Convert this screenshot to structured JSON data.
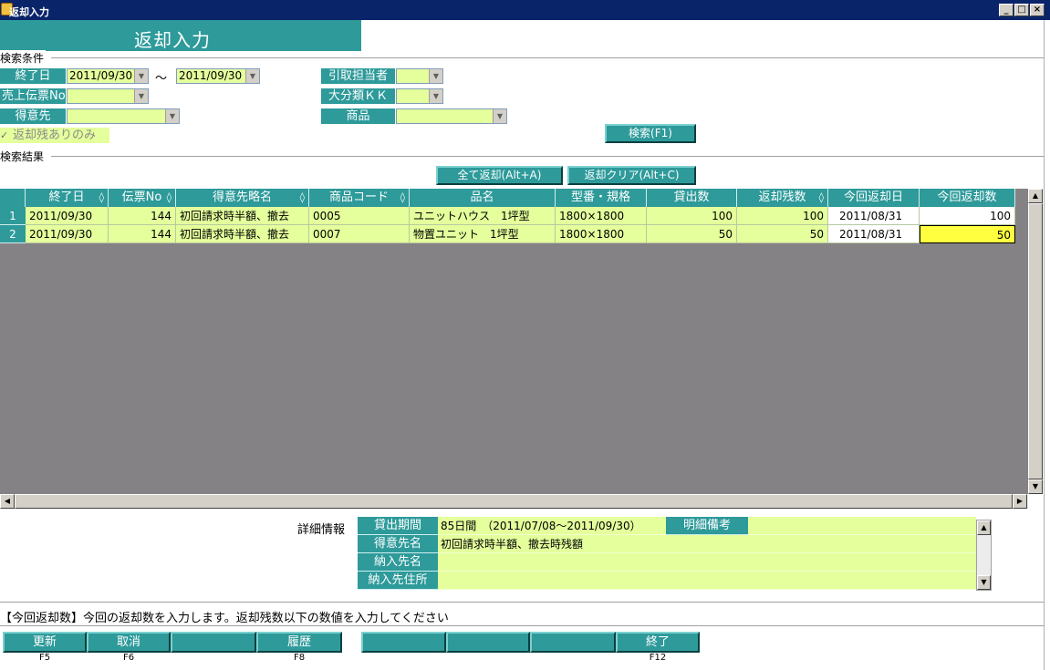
{
  "window": {
    "title": "返却入力",
    "controls": [
      "_",
      "□",
      "×"
    ]
  },
  "header": {
    "title": "返却入力"
  },
  "search": {
    "group_title": "検索条件",
    "end_date_label": "終了日",
    "date_from": "2011/09/30",
    "tilde": "～",
    "date_to": "2011/09/30",
    "slip_no_label": "売上伝票No",
    "customer_label": "得意先",
    "pickup_staff_label": "引取担当者",
    "category_label": "大分類ＫＫ",
    "product_label": "商品",
    "checkbox_label": "返却残ありのみ",
    "checkbox_mark": "✓",
    "search_button": "検索(F1)"
  },
  "results": {
    "group_title": "検索結果",
    "return_all_button": "全て返却(Alt+A)",
    "return_clear_button": "返却クリア(Alt+C)",
    "sort_glyph": "◊",
    "columns": [
      "終了日",
      "伝票No",
      "得意先略名",
      "商品コード",
      "品名",
      "型番・規格",
      "貸出数",
      "返却残数",
      "今回返却日",
      "今回返却数"
    ],
    "rows": [
      {
        "num": "1",
        "end_date": "2011/09/30",
        "slip_no": "144",
        "customer": "初回請求時半額、撤去",
        "code": "0005",
        "name": "ユニットハウス　1坪型",
        "spec": "1800×1800",
        "lent": "100",
        "remaining": "100",
        "return_date": "2011/08/31",
        "return_qty": "100"
      },
      {
        "num": "2",
        "end_date": "2011/09/30",
        "slip_no": "144",
        "customer": "初回請求時半額、撤去",
        "code": "0007",
        "name": "物置ユニット　1坪型",
        "spec": "1800×1800",
        "lent": "50",
        "remaining": "50",
        "return_date": "2011/08/31",
        "return_qty": "50"
      }
    ]
  },
  "detail": {
    "section_label": "詳細情報",
    "period_label": "貸出期間",
    "period_value": "85日間　（2011/07/08～2011/09/30）",
    "remark_label": "明細備考",
    "customer_name_label": "得意先名",
    "customer_name_value": "初回請求時半額、撤去時残額",
    "delivery_name_label": "納入先名",
    "delivery_addr_label": "納入先住所"
  },
  "status": {
    "message": "【今回返却数】今回の返却数を入力します。返却残数以下の数値を入力してください"
  },
  "fkeys": [
    {
      "label": "更新",
      "caption": "F5"
    },
    {
      "label": "取消",
      "caption": "F6"
    },
    {
      "label": "",
      "caption": ""
    },
    {
      "label": "履歴",
      "caption": "F8"
    },
    {
      "label": "",
      "caption": ""
    },
    {
      "label": "",
      "caption": ""
    },
    {
      "label": "",
      "caption": ""
    },
    {
      "label": "終了",
      "caption": "F12"
    }
  ],
  "colors": {
    "teal": "#2e9a9a",
    "cell_bg": "#e4ff9c",
    "grid_bg": "#858285",
    "selected_cell": "#ffff40",
    "titlebar": "#0a246a"
  }
}
